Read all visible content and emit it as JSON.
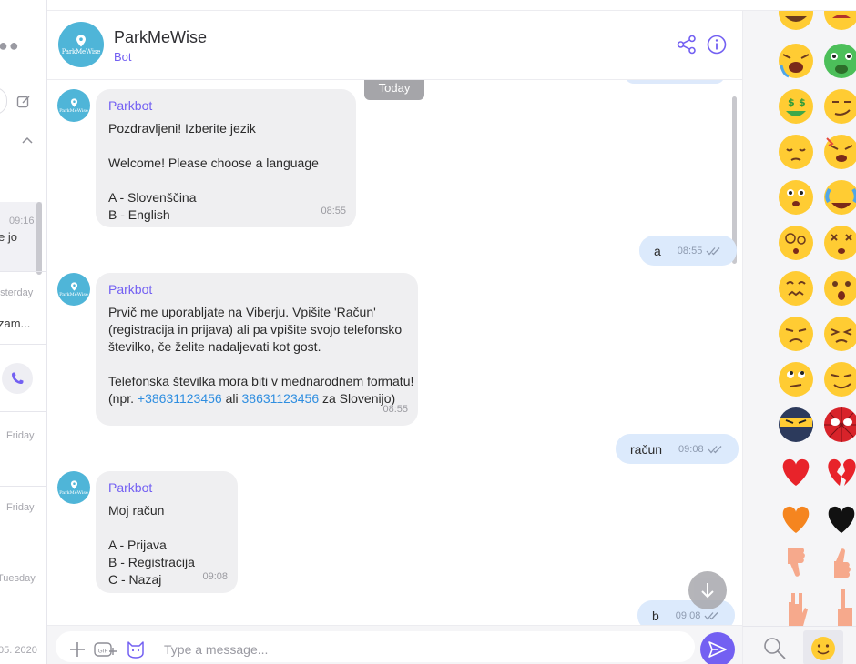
{
  "left_list": {
    "items": [
      {
        "time": "09:16",
        "preview": "e jo"
      },
      {
        "time": "esterday",
        "preview": "zam..."
      },
      {
        "time": "Friday"
      },
      {
        "time": "Friday"
      },
      {
        "time": "Tuesday"
      },
      {
        "time": "05. 2020"
      }
    ]
  },
  "header": {
    "name": "ParkMeWise",
    "subtitle": "Bot",
    "avatar_text": "ParkMeWise"
  },
  "chat": {
    "date_divider": "Today",
    "messages": [
      {
        "sender": "Parkbot",
        "lines": [
          "Pozdravljeni! Izberite jezik",
          "",
          "Welcome! Please choose a language",
          "",
          "A - Slovenščina",
          "B - English"
        ],
        "time": "08:55"
      },
      {
        "text": "a",
        "time": "08:55"
      },
      {
        "sender": "Parkbot",
        "lines": [
          "Prvič me uporabljate na Viberju. Vpišite 'Račun'",
          "(registracija in prijava) ali pa vpišite svojo telefonsko",
          "številko, če želite nadaljevati kot gost.",
          "",
          "Telefonska številka mora biti v mednarodnem formatu!"
        ],
        "last_line": {
          "pre": "(npr. ",
          "link1": "+38631123456",
          "mid": " ali ",
          "link2": "38631123456",
          "post": " za Slovenijo)"
        },
        "time": "08:55"
      },
      {
        "text": "račun",
        "time": "09:08"
      },
      {
        "sender": "Parkbot",
        "lines": [
          "Moj račun",
          "",
          "A - Prijava",
          "B - Registracija",
          "C - Nazaj"
        ],
        "time": "09:08"
      },
      {
        "text": "b",
        "time": "09:08"
      }
    ]
  },
  "composer": {
    "placeholder": "Type a message...",
    "gif_label": "GIF"
  },
  "emoji_panel": {
    "rows": [
      [
        "grinning-face",
        "angry-face"
      ],
      [
        "anguished-face",
        "nauseated-face"
      ],
      [
        "money-mouth-face",
        "smirking-face"
      ],
      [
        "pensive-face",
        "rage-face"
      ],
      [
        "squinting-face",
        "tears-of-joy-face"
      ],
      [
        "dizzy-face",
        "knocked-out-face"
      ],
      [
        "confounded-face",
        "astonished-face"
      ],
      [
        "annoyed-face",
        "persevering-face"
      ],
      [
        "rolling-eyes-face",
        "smirk-face"
      ],
      [
        "ninja-face",
        "spider-face"
      ],
      [
        "red-heart",
        "broken-heart"
      ],
      [
        "orange-heart",
        "black-heart"
      ],
      [
        "thumbs-down",
        "thumbs-up"
      ],
      [
        "rock-on-hand",
        "pointing-up-hand"
      ]
    ]
  },
  "colors": {
    "accent": "#7360f2",
    "bot_avatar": "#4fb5d8",
    "incoming_bubble": "#efeff1",
    "outgoing_bubble": "#dceafc",
    "link": "#2f8ee0"
  }
}
